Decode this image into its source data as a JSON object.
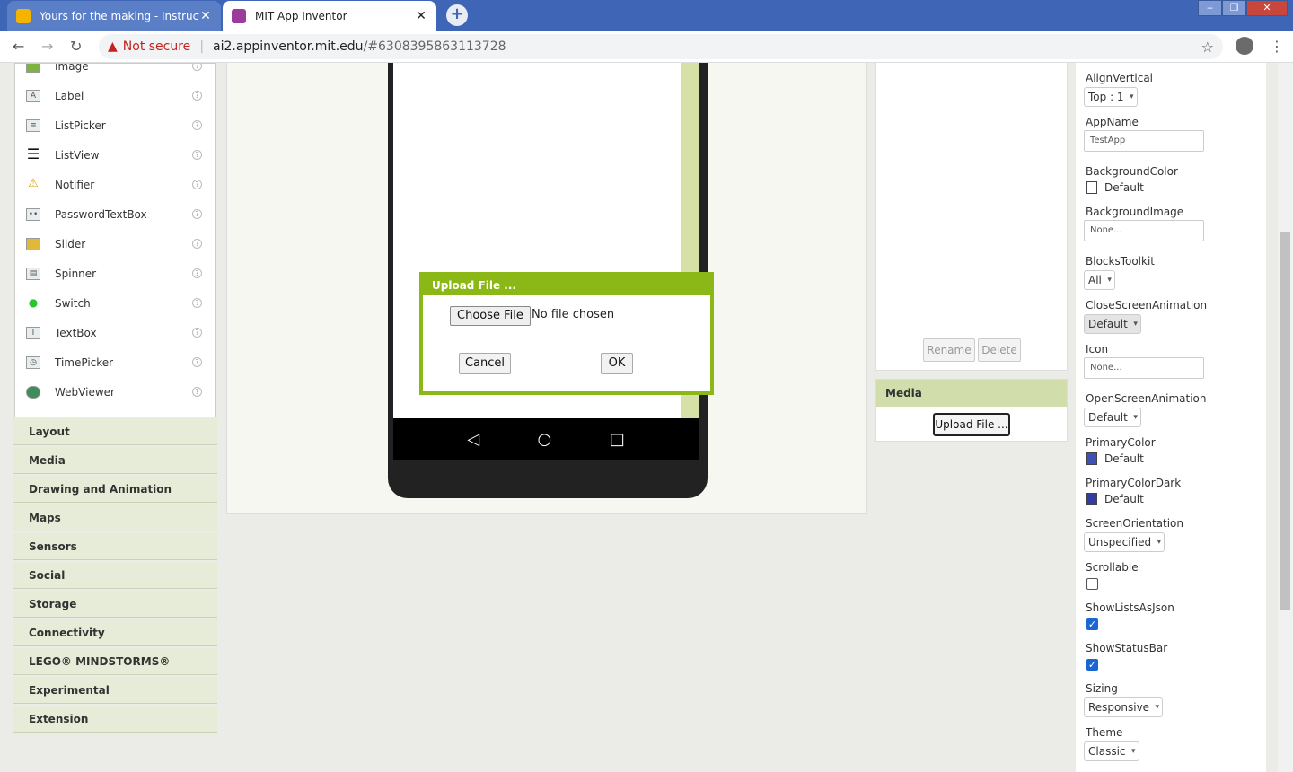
{
  "browser": {
    "tabs": [
      {
        "title": "Yours for the making - Instructab",
        "close": "✕"
      },
      {
        "title": "MIT App Inventor",
        "close": "✕"
      }
    ],
    "new_tab": "+",
    "url_warning": "Not secure",
    "url_host": "ai2.appinventor.mit.edu",
    "url_path": "/#6308395863113728"
  },
  "palette": {
    "items": [
      {
        "label": "Image",
        "icon": "image-icon"
      },
      {
        "label": "Label",
        "icon": "label-icon"
      },
      {
        "label": "ListPicker",
        "icon": "listpicker-icon"
      },
      {
        "label": "ListView",
        "icon": "listview-icon"
      },
      {
        "label": "Notifier",
        "icon": "notifier-icon"
      },
      {
        "label": "PasswordTextBox",
        "icon": "password-icon"
      },
      {
        "label": "Slider",
        "icon": "slider-icon"
      },
      {
        "label": "Spinner",
        "icon": "spinner-icon"
      },
      {
        "label": "Switch",
        "icon": "switch-icon"
      },
      {
        "label": "TextBox",
        "icon": "textbox-icon"
      },
      {
        "label": "TimePicker",
        "icon": "timepicker-icon"
      },
      {
        "label": "WebViewer",
        "icon": "webviewer-icon"
      }
    ],
    "help": "?",
    "categories": [
      "Layout",
      "Media",
      "Drawing and Animation",
      "Maps",
      "Sensors",
      "Social",
      "Storage",
      "Connectivity",
      "LEGO® MINDSTORMS®",
      "Experimental",
      "Extension"
    ]
  },
  "dialog": {
    "title": "Upload File ...",
    "choose_file": "Choose File",
    "no_file": "No file chosen",
    "cancel": "Cancel",
    "ok": "OK"
  },
  "components": {
    "rename": "Rename",
    "delete": "Delete"
  },
  "media": {
    "header": "Media",
    "upload": "Upload File ..."
  },
  "properties": {
    "align_vertical": {
      "label": "AlignVertical",
      "value": "Top : 1"
    },
    "app_name": {
      "label": "AppName",
      "value": "TestApp"
    },
    "background_color": {
      "label": "BackgroundColor",
      "value": "Default",
      "swatch": "#ffffff"
    },
    "background_image": {
      "label": "BackgroundImage",
      "value": "None..."
    },
    "blocks_toolkit": {
      "label": "BlocksToolkit",
      "value": "All"
    },
    "close_screen_animation": {
      "label": "CloseScreenAnimation",
      "value": "Default"
    },
    "icon": {
      "label": "Icon",
      "value": "None..."
    },
    "open_screen_animation": {
      "label": "OpenScreenAnimation",
      "value": "Default"
    },
    "primary_color": {
      "label": "PrimaryColor",
      "value": "Default",
      "swatch": "#3f51b5"
    },
    "primary_color_dark": {
      "label": "PrimaryColorDark",
      "value": "Default",
      "swatch": "#303f9f"
    },
    "screen_orientation": {
      "label": "ScreenOrientation",
      "value": "Unspecified"
    },
    "scrollable": {
      "label": "Scrollable",
      "checked": false
    },
    "show_lists_as_json": {
      "label": "ShowListsAsJson",
      "checked": true
    },
    "show_status_bar": {
      "label": "ShowStatusBar",
      "checked": true
    },
    "sizing": {
      "label": "Sizing",
      "value": "Responsive"
    },
    "theme": {
      "label": "Theme",
      "value": "Classic"
    }
  },
  "colors": {
    "accent_green": "#8bb816",
    "chrome_blue": "#3f66b6"
  }
}
